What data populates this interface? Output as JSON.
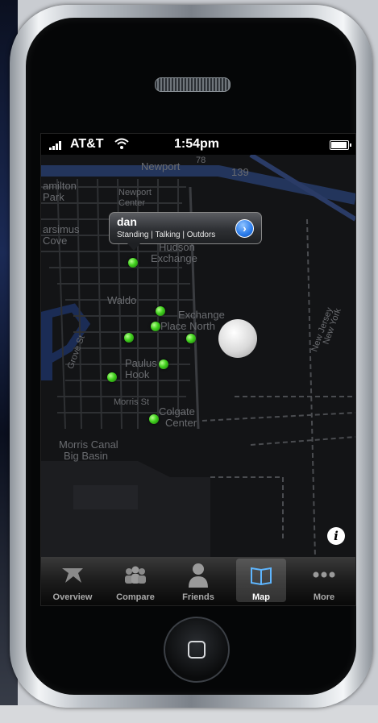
{
  "status_bar": {
    "carrier": "AT&T",
    "time": "1:54pm",
    "signal_bars": 4,
    "wifi": "wifi-icon",
    "battery_level": 0.9
  },
  "map": {
    "labels": [
      "Newport",
      "139",
      "amilton",
      "Park",
      "Newport",
      "Center",
      "arsimus",
      "Cove",
      "Hudson",
      "Exchange",
      "Waldo",
      "Exchange",
      "Place North",
      "Grove St",
      "Paulus",
      "Hook",
      "Morris St",
      "Colgate",
      "Center",
      "Morris Canal",
      "Big Basin",
      "New Jersey",
      "New York",
      "78"
    ],
    "callout": {
      "title": "dan",
      "subtitle": "Standing | Talking | Outdors"
    },
    "info_label": "i"
  },
  "tabs": [
    {
      "label": "Overview",
      "icon": "overview-icon",
      "active": false
    },
    {
      "label": "Compare",
      "icon": "compare-icon",
      "active": false
    },
    {
      "label": "Friends",
      "icon": "friends-icon",
      "active": false
    },
    {
      "label": "Map",
      "icon": "book-icon",
      "active": true
    },
    {
      "label": "More",
      "icon": "more-icon",
      "active": false
    }
  ],
  "colors": {
    "pin": "#3fcf1c",
    "disclosure": "#2a7bea",
    "map_background": "#131416"
  }
}
